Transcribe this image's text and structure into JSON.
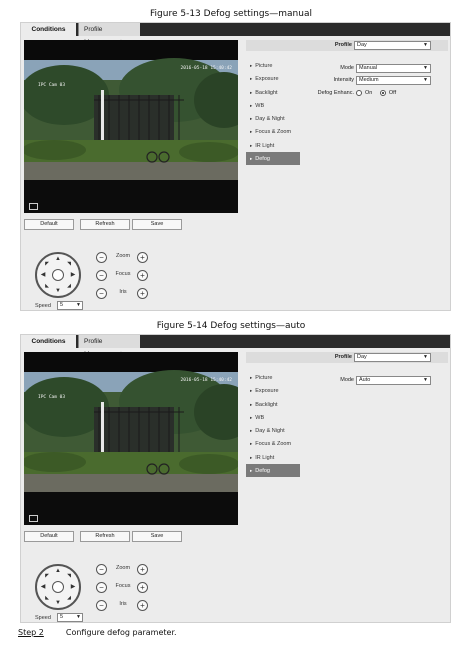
{
  "figures": [
    {
      "caption": "Figure 5-13 Defog settings—manual",
      "tabs": {
        "active": "Conditions",
        "inactive": "Profile Management"
      },
      "video": {
        "timestamp": "2016-05-18 15:40:42",
        "camera_label": "IPC Cam 03"
      },
      "buttons": {
        "default": "Default",
        "refresh": "Refresh",
        "save": "Save"
      },
      "ptz": {
        "zoom": "Zoom",
        "focus": "Focus",
        "iris": "Iris",
        "speed_label": "Speed",
        "speed_value": "5"
      },
      "profile": {
        "label": "Profile",
        "value": "Day"
      },
      "menu": [
        "Picture",
        "Exposure",
        "Backlight",
        "WB",
        "Day & Night",
        "Focus & Zoom",
        "IR Light",
        "Defog"
      ],
      "selected_menu": "Defog",
      "fields": {
        "mode_label": "Mode",
        "mode_value": "Manual",
        "intensity_label": "Intensity",
        "intensity_value": "Medium",
        "enhance_label": "Defog Enhanc.",
        "on_label": "On",
        "off_label": "Off",
        "enhance_value": "Off"
      }
    },
    {
      "caption": "Figure 5-14 Defog settings—auto",
      "tabs": {
        "active": "Conditions",
        "inactive": "Profile Management"
      },
      "video": {
        "timestamp": "2016-05-18 15:40:42",
        "camera_label": "IPC Cam 03"
      },
      "buttons": {
        "default": "Default",
        "refresh": "Refresh",
        "save": "Save"
      },
      "ptz": {
        "zoom": "Zoom",
        "focus": "Focus",
        "iris": "Iris",
        "speed_label": "Speed",
        "speed_value": "5"
      },
      "profile": {
        "label": "Profile",
        "value": "Day"
      },
      "menu": [
        "Picture",
        "Exposure",
        "Backlight",
        "WB",
        "Day & Night",
        "Focus & Zoom",
        "IR Light",
        "Defog"
      ],
      "selected_menu": "Defog",
      "fields": {
        "mode_label": "Mode",
        "mode_value": "Auto"
      }
    }
  ],
  "step": {
    "number": "Step 2",
    "text": "Configure defog parameter."
  }
}
